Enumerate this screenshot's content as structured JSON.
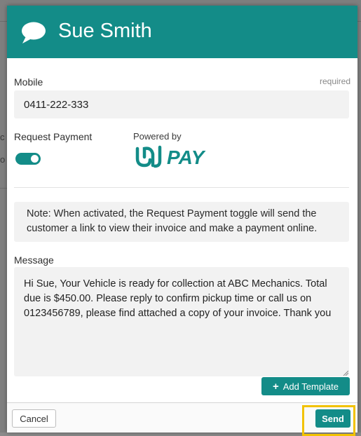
{
  "background": {
    "fragment_1": "c",
    "fragment_2": "o"
  },
  "modal": {
    "title": "Sue Smith",
    "header_icon": "chat-bubble-icon"
  },
  "mobile": {
    "label": "Mobile",
    "required_text": "required",
    "value": "0411-222-333"
  },
  "payment": {
    "label": "Request Payment",
    "toggle_on": true,
    "powered_by": "Powered by",
    "logo_text": "PAY",
    "logo_mark": "ezidebit-pay-logo"
  },
  "note": {
    "text": "Note: When activated, the Request Payment toggle will send the customer a link to view their invoice and make a payment online."
  },
  "message": {
    "label": "Message",
    "value": "Hi Sue, Your Vehicle is ready for collection at ABC Mechanics. Total due is $450.00. Please reply to confirm pickup time or call us on 0123456789, please find attached a copy of your invoice. Thank you"
  },
  "buttons": {
    "add_template": "Add Template",
    "cancel": "Cancel",
    "send": "Send"
  },
  "colors": {
    "accent": "#138c88",
    "highlight": "#f2c200"
  }
}
